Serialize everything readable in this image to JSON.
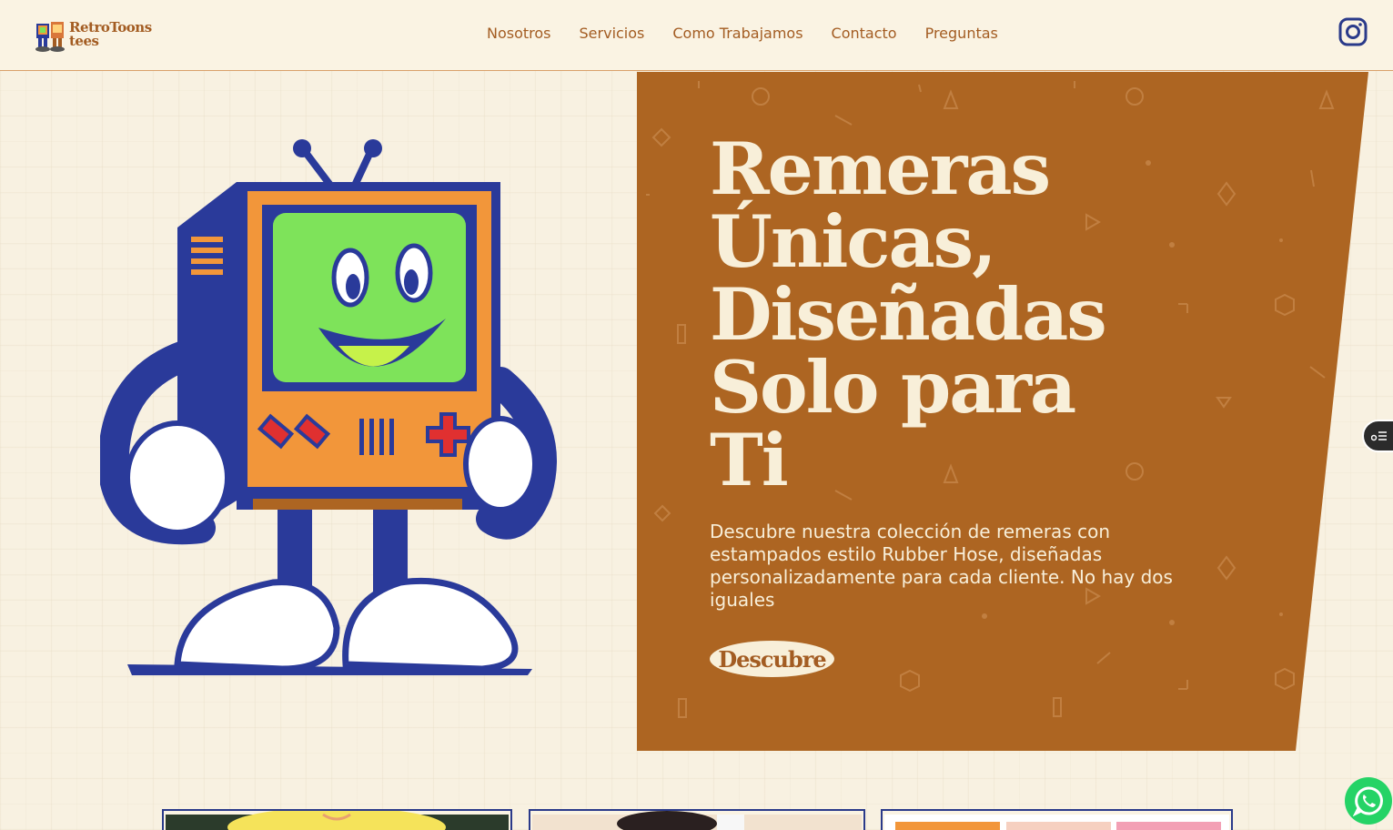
{
  "brand": {
    "name_line1": "RetroToons",
    "name_line2": "tees"
  },
  "nav": {
    "items": [
      "Nosotros",
      "Servicios",
      "Como Trabajamos",
      "Contacto",
      "Preguntas"
    ]
  },
  "hero": {
    "title_lines": [
      "Remeras",
      "Únicas,",
      "Diseñadas",
      "Solo para",
      "Ti"
    ],
    "description": "Descubre nuestra colección de remeras con estampados estilo Rubber Hose, diseñadas personalizadamente para cada cliente. No hay dos iguales",
    "cta_label": "Descubre"
  },
  "colors": {
    "background": "#f8f1e1",
    "accent": "#ad6522",
    "cream": "#f8efd9",
    "mascot_blue": "#2a3a9a",
    "mascot_orange": "#f2963a",
    "mascot_green": "#7ee35a",
    "whatsapp": "#25d366"
  },
  "icons": [
    "logo-mascot-icon",
    "instagram-icon",
    "side-menu-icon",
    "whatsapp-icon"
  ]
}
